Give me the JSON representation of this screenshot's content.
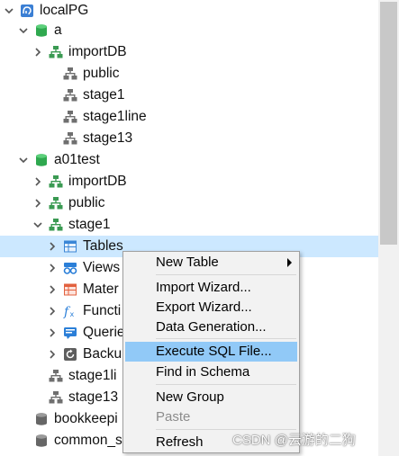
{
  "tree": [
    {
      "label": "localPG",
      "icon": "elephant-connection-icon",
      "chevron": "down"
    },
    {
      "label": "a",
      "icon": "database-green-icon",
      "chevron": "down"
    },
    {
      "label": "importDB",
      "icon": "schema-green-icon",
      "chevron": "right"
    },
    {
      "label": "public",
      "icon": "schema-gray-icon",
      "chevron": "none"
    },
    {
      "label": "stage1",
      "icon": "schema-gray-icon",
      "chevron": "none"
    },
    {
      "label": "stage1line",
      "icon": "schema-gray-icon",
      "chevron": "none"
    },
    {
      "label": "stage13",
      "icon": "schema-gray-icon",
      "chevron": "none"
    },
    {
      "label": "a01test",
      "icon": "database-green-icon",
      "chevron": "down"
    },
    {
      "label": "importDB",
      "icon": "schema-green-icon",
      "chevron": "right"
    },
    {
      "label": "public",
      "icon": "schema-green-icon",
      "chevron": "right"
    },
    {
      "label": "stage1",
      "icon": "schema-green-icon",
      "chevron": "down"
    },
    {
      "label": "Tables",
      "icon": "table-icon",
      "chevron": "right"
    },
    {
      "label": "Views",
      "icon": "view-icon",
      "chevron": "right"
    },
    {
      "label": "Mater",
      "icon": "materialized-view-icon",
      "chevron": "right"
    },
    {
      "label": "Functi",
      "icon": "function-icon",
      "chevron": "right"
    },
    {
      "label": "Querie",
      "icon": "query-icon",
      "chevron": "right"
    },
    {
      "label": "Backu",
      "icon": "backup-icon",
      "chevron": "right"
    },
    {
      "label": "stage1li",
      "icon": "schema-gray-icon",
      "chevron": "none"
    },
    {
      "label": "stage13",
      "icon": "schema-gray-icon",
      "chevron": "none"
    },
    {
      "label": "bookkeepi",
      "icon": "database-gray-icon",
      "chevron": "none"
    },
    {
      "label": "common_s",
      "icon": "database-gray-icon",
      "chevron": "none"
    }
  ],
  "context_menu": {
    "items": [
      {
        "label": "New Table",
        "submenu": true
      },
      {
        "label": "Import Wizard..."
      },
      {
        "label": "Export Wizard..."
      },
      {
        "label": "Data Generation..."
      },
      {
        "label": "Execute SQL File...",
        "highlighted": true
      },
      {
        "label": "Find in Schema"
      },
      {
        "label": "New Group"
      },
      {
        "label": "Paste",
        "disabled": true
      },
      {
        "label": "Refresh"
      }
    ]
  },
  "watermark": "CSDN @云游的二狗",
  "colors": {
    "selection": "#cce8ff",
    "menu_highlight": "#91c9f7",
    "db_green": "#2fa84f",
    "schema_green": "#3a9a52",
    "schema_gray": "#6f6f6f"
  }
}
